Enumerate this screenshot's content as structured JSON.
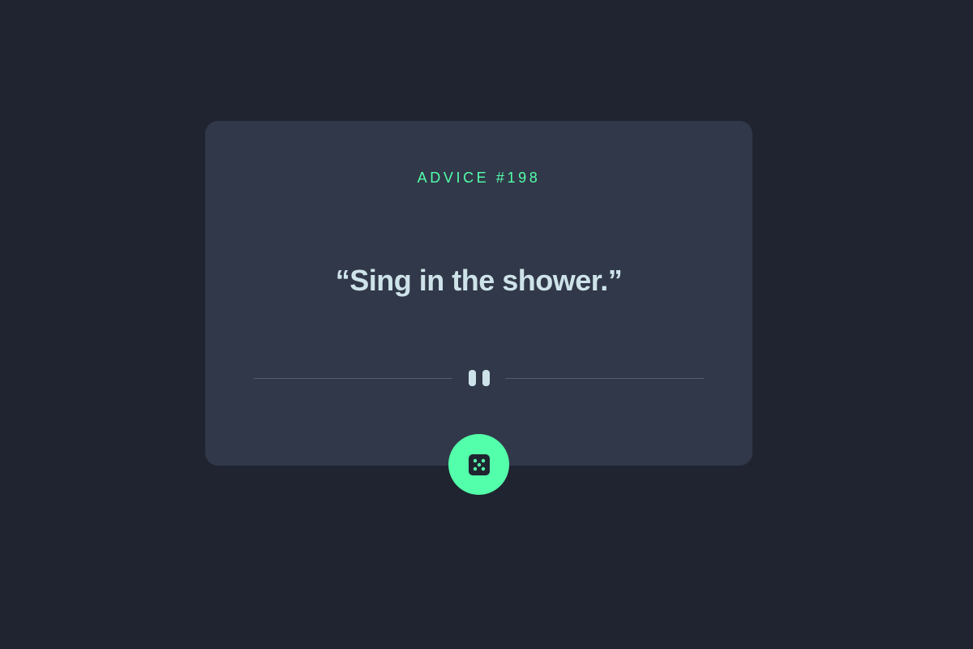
{
  "card": {
    "advice_label": "ADVICE #",
    "advice_number": "198",
    "quote": "“Sing in the shower.”"
  },
  "divider": {
    "icon": "pause-icon"
  },
  "dice_button": {
    "icon": "dice-icon"
  },
  "colors": {
    "background": "#1f2430",
    "card": "#313849",
    "accent": "#53ffaa",
    "text": "#cee3e9",
    "divider_line": "#4f5d74"
  }
}
